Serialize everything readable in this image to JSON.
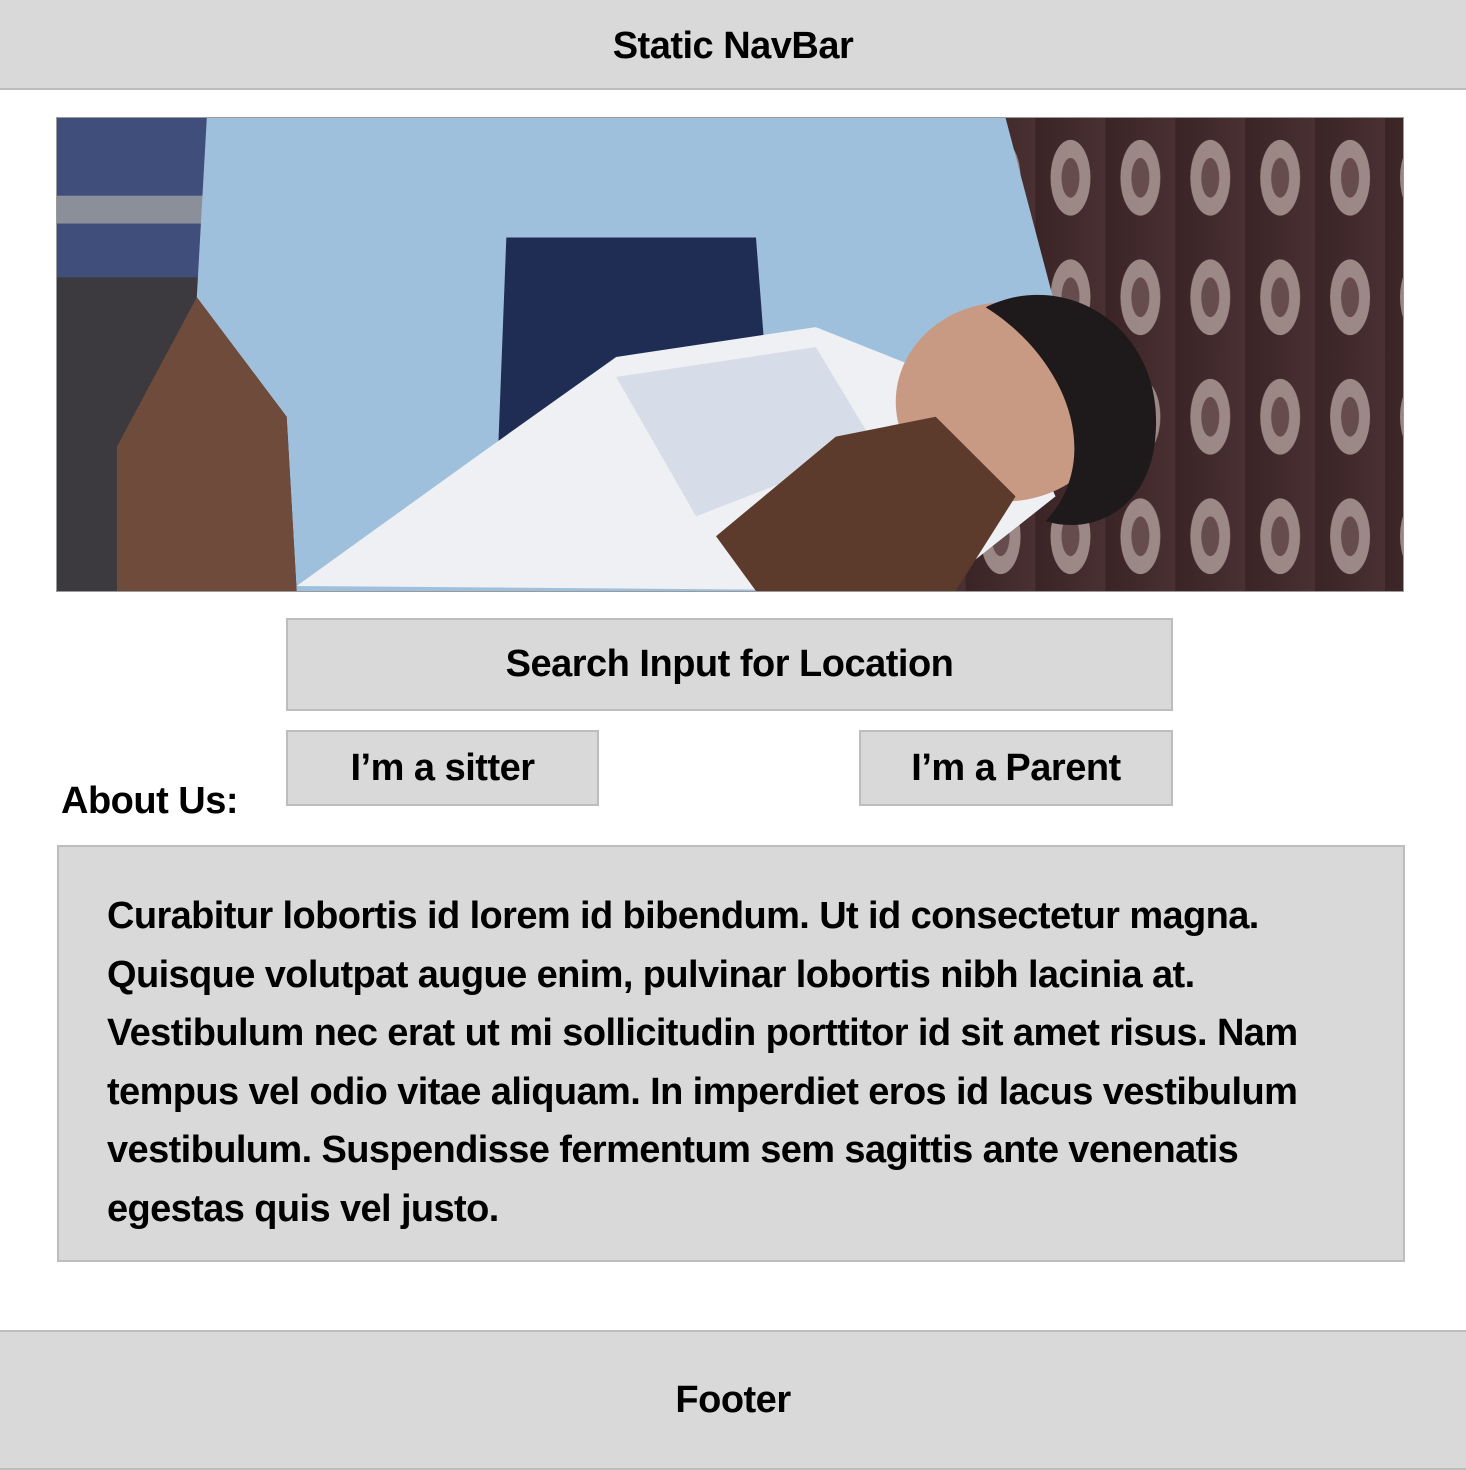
{
  "navbar": {
    "title": "Static NavBar"
  },
  "hero": {
    "image_description_icon": "photo-person-holding-baby"
  },
  "search": {
    "label": "Search Input for Location"
  },
  "buttons": {
    "sitter": "I’m a sitter",
    "parent": "I’m a Parent"
  },
  "about": {
    "label": "About Us:",
    "text": "Curabitur lobortis id lorem id bibendum. Ut id consectetur magna. Quisque volutpat augue enim, pulvinar lobortis nibh lacinia at. Vestibulum nec erat ut mi sollicitudin porttitor id sit amet risus. Nam tempus vel odio vitae aliquam. In imperdiet eros id lacus vestibulum vestibulum. Suspendisse fermentum sem sagittis ante venenatis egestas quis vel justo."
  },
  "footer": {
    "label": "Footer"
  },
  "colors": {
    "box_bg": "#d9d9d9",
    "box_border": "#bdbdbd",
    "page_bg": "#ffffff"
  }
}
